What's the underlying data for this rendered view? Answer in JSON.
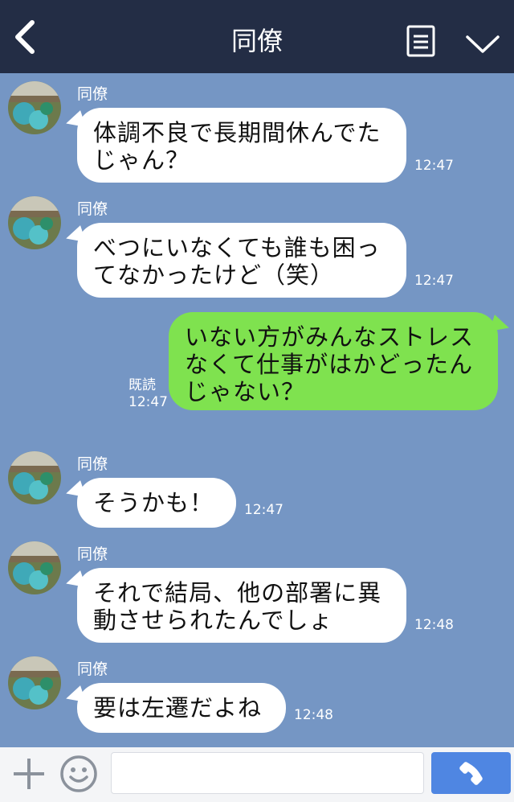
{
  "header": {
    "title": "同僚",
    "back_icon": "chevron-left-icon",
    "menu_icon": "document-menu-icon",
    "collapse_icon": "chevron-down-icon",
    "background_color": "#232d45"
  },
  "chat": {
    "background_color": "#7596c4",
    "incoming_bubble_color": "#ffffff",
    "outgoing_bubble_color": "#7fe24f",
    "messages": [
      {
        "direction": "incoming",
        "sender": "同僚",
        "lines": [
          "体調不良で長期間休んでた",
          "じゃん？"
        ],
        "time": "12:47"
      },
      {
        "direction": "incoming",
        "sender": "同僚",
        "lines": [
          "べつにいなくても誰も困っ",
          "てなかったけど（笑）"
        ],
        "time": "12:47"
      },
      {
        "direction": "outgoing",
        "read_label": "既読",
        "lines": [
          "いない方がみんなストレス",
          "なくて仕事がはかどったん",
          "じゃない？"
        ],
        "time": "12:47"
      },
      {
        "direction": "incoming",
        "sender": "同僚",
        "lines": [
          "そうかも！"
        ],
        "time": "12:47"
      },
      {
        "direction": "incoming",
        "sender": "同僚",
        "lines": [
          "それで結局、他の部署に異",
          "動させられたんでしょ"
        ],
        "time": "12:48"
      },
      {
        "direction": "incoming",
        "sender": "同僚",
        "lines": [
          "要は左遷だよね"
        ],
        "time": "12:48"
      }
    ]
  },
  "footer": {
    "plus_icon": "plus-icon",
    "emoji_icon": "smiley-icon",
    "message_input_value": "",
    "call_icon": "phone-icon",
    "call_button_color": "#4f86e2"
  }
}
